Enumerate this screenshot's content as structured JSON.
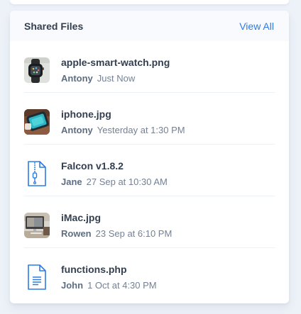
{
  "header": {
    "title": "Shared Files",
    "view_all": "View All"
  },
  "files": [
    {
      "name": "apple-smart-watch.png",
      "user": "Antony",
      "time": "Just Now",
      "icon": "watch-image"
    },
    {
      "name": "iphone.jpg",
      "user": "Antony",
      "time": "Yesterday at 1:30 PM",
      "icon": "phone-image"
    },
    {
      "name": "Falcon v1.8.2",
      "user": "Jane",
      "time": "27 Sep at 10:30 AM",
      "icon": "zip-file-icon"
    },
    {
      "name": "iMac.jpg",
      "user": "Rowen",
      "time": "23 Sep at 6:10 PM",
      "icon": "imac-image"
    },
    {
      "name": "functions.php",
      "user": "John",
      "time": "1 Oct at 4:30 PM",
      "icon": "document-icon"
    }
  ],
  "colors": {
    "accent": "#2c7be5",
    "title": "#344050",
    "muted": "#748194",
    "page_bg": "#edf2f9"
  }
}
